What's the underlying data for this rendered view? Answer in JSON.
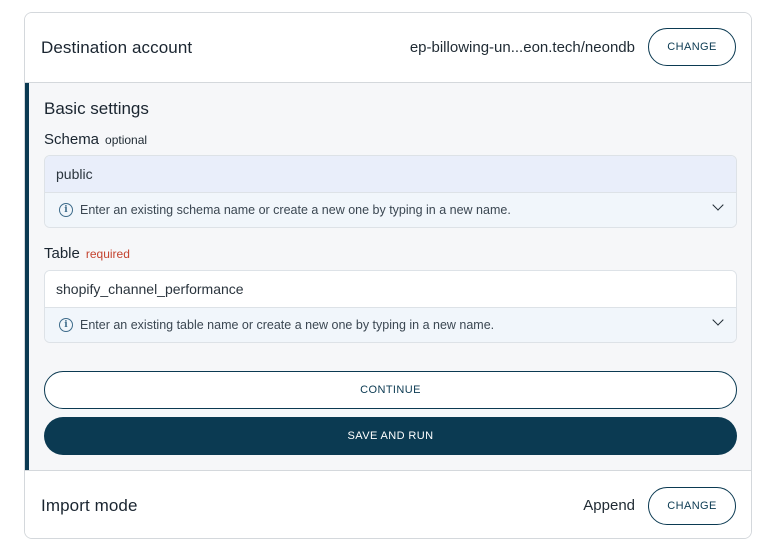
{
  "destination": {
    "title": "Destination account",
    "value": "ep-billowing-un...eon.tech/neondb",
    "change_label": "CHANGE"
  },
  "basic_settings": {
    "title": "Basic settings",
    "schema": {
      "label": "Schema",
      "tag": "optional",
      "value": "public",
      "help": "Enter an existing schema name or create a new one by typing in a new name."
    },
    "table": {
      "label": "Table",
      "tag": "required",
      "value": "shopify_channel_performance",
      "help": "Enter an existing table name or create a new one by typing in a new name."
    },
    "continue_label": "CONTINUE",
    "save_label": "SAVE AND RUN"
  },
  "import_mode": {
    "title": "Import mode",
    "value": "Append",
    "change_label": "CHANGE"
  },
  "colors": {
    "accent": "#0b3a52",
    "required": "#c4432f",
    "schema_input_bg": "#e9eefa",
    "help_bg": "#f1f6fb",
    "section_bg": "#f6f7f9"
  },
  "icons": {
    "info": "info-icon",
    "dropdown": "chevron-down-icon"
  }
}
